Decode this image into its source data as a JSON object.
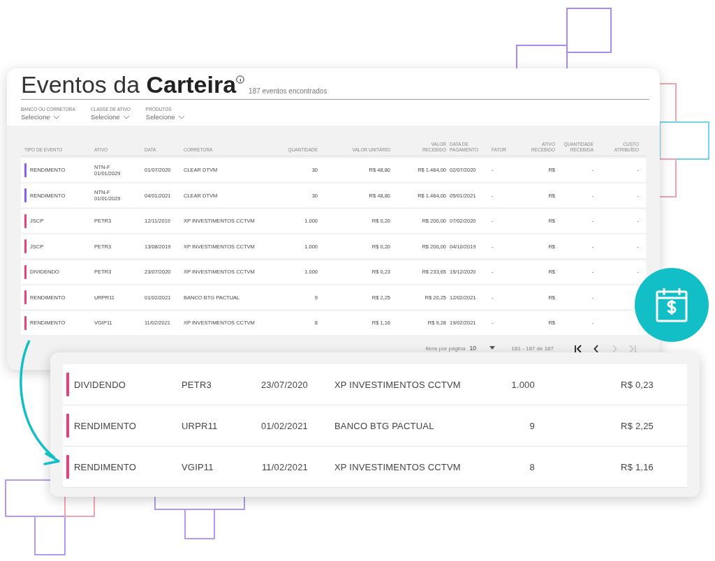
{
  "header": {
    "title": "Eventos da **Carteira**",
    "count": "187 eventos encontrados"
  },
  "filters": [
    {
      "label": "BANCO OU CORRETORA",
      "value": "Selecione"
    },
    {
      "label": "CLASSE DE ATIVO",
      "value": "Selecione"
    },
    {
      "label": "PRODUTOS",
      "value": "Selecione"
    }
  ],
  "table": {
    "columns": [
      "TIPO DE EVENTO",
      "ATIVO",
      "DATA",
      "CORRETORA",
      "QUANTIDADE",
      "VALOR UNITÁRIO",
      "VALOR RECEBIDO",
      "DATA DE PAGAMENTO",
      "FATOR",
      "ATIVO RECEBIDO",
      "QUANTIDADE RECEBIDA",
      "CUSTO ATRIBUÍDO"
    ],
    "rows": [
      {
        "color": "#8a5cf0",
        "cells": [
          "RENDIMENTO",
          "NTN-F 01/01/2029",
          "01/07/2020",
          "CLEAR DTVM",
          "30",
          "R$ 48,80",
          "R$ 1.464,00",
          "02/07/2020",
          "-",
          "R$",
          "-",
          "-"
        ]
      },
      {
        "color": "#8a5cf0",
        "cells": [
          "RENDIMENTO",
          "NTN-F 01/01/2029",
          "04/01/2021",
          "CLEAR DTVM",
          "30",
          "R$ 48,80",
          "R$ 1.464,00",
          "05/01/2021",
          "-",
          "R$",
          "-",
          "-"
        ]
      },
      {
        "color": "#e8407c",
        "cells": [
          "JSCP",
          "PETR3",
          "12/11/2019",
          "XP INVESTIMENTOS CCTVM",
          "1.000",
          "R$ 0,20",
          "R$ 200,00",
          "07/02/2020",
          "-",
          "R$",
          "-",
          "-"
        ]
      },
      {
        "color": "#e8407c",
        "cells": [
          "JSCP",
          "PETR3",
          "13/08/2019",
          "XP INVESTIMENTOS CCTVM",
          "1.000",
          "R$ 0,20",
          "R$ 200,00",
          "04/10/2019",
          "-",
          "R$",
          "-",
          "-"
        ]
      },
      {
        "color": "#e8407c",
        "cells": [
          "DIVIDENDO",
          "PETR3",
          "23/07/2020",
          "XP INVESTIMENTOS CCTVM",
          "1.000",
          "R$ 0,23",
          "R$ 233,65",
          "15/12/2020",
          "-",
          "R$",
          "-",
          "-"
        ]
      },
      {
        "color": "#e8407c",
        "cells": [
          "RENDIMENTO",
          "URPR11",
          "01/02/2021",
          "BANCO BTG PACTUAL",
          "9",
          "R$ 2,25",
          "R$ 20,25",
          "12/02/2021",
          "-",
          "R$",
          "-"
        ]
      },
      {
        "color": "#e8407c",
        "cells": [
          "RENDIMENTO",
          "VGIP11",
          "11/02/2021",
          "XP INVESTIMENTOS CCTVM",
          "8",
          "R$ 1,16",
          "R$ 9,28",
          "19/02/2021",
          "-",
          "R$",
          "-"
        ]
      }
    ]
  },
  "pagination": {
    "label": "Itens por página",
    "page_size": "10",
    "range": "181 - 187 de 187",
    "nav": [
      {
        "kind": "first",
        "disabled": false
      },
      {
        "kind": "prev",
        "disabled": false
      },
      {
        "kind": "next",
        "disabled": true
      },
      {
        "kind": "last",
        "disabled": true
      }
    ]
  },
  "zoom": {
    "rows": [
      {
        "color": "#e8407c",
        "cells": [
          "DIVIDENDO",
          "PETR3",
          "23/07/2020",
          "XP INVESTIMENTOS CCTVM",
          "1.000",
          "R$ 0,23"
        ]
      },
      {
        "color": "#e8407c",
        "cells": [
          "RENDIMENTO",
          "URPR11",
          "01/02/2021",
          "BANCO BTG PACTUAL",
          "9",
          "R$ 2,25"
        ]
      },
      {
        "color": "#e8407c",
        "cells": [
          "RENDIMENTO",
          "VGIP11",
          "11/02/2021",
          "XP INVESTIMENTOS CCTVM",
          "8",
          "R$ 1,16"
        ]
      }
    ]
  }
}
